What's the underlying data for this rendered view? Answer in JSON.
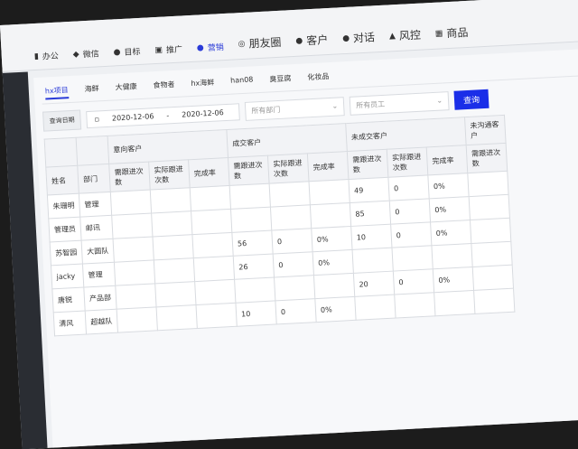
{
  "topnav": [
    {
      "icon": "briefcase-icon",
      "glyph": "▮",
      "label": "办公"
    },
    {
      "icon": "tag-icon",
      "glyph": "◆",
      "label": "微信"
    },
    {
      "icon": "target-icon",
      "glyph": "●",
      "label": "目标"
    },
    {
      "icon": "monitor-icon",
      "glyph": "▣",
      "label": "推广"
    },
    {
      "icon": "user-icon",
      "glyph": "●",
      "label": "营销",
      "active": true
    },
    {
      "icon": "circle-icon",
      "glyph": "◎",
      "label": "朋友圈"
    },
    {
      "icon": "users-icon",
      "glyph": "●",
      "label": "客户"
    },
    {
      "icon": "chat-icon",
      "glyph": "●",
      "label": "对话"
    },
    {
      "icon": "shield-icon",
      "glyph": "▲",
      "label": "风控"
    },
    {
      "icon": "grid-icon",
      "glyph": "▦",
      "label": "商品"
    }
  ],
  "tabs": [
    "hx项目",
    "海鲜",
    "大健康",
    "食物者",
    "hx海鲜",
    "han08",
    "臭豆腐",
    "化妆品"
  ],
  "filters": {
    "date_label": "查询日期",
    "start": "2020-12-06",
    "sep": "-",
    "end": "2020-12-06",
    "dept_placeholder": "所有部门",
    "staff_placeholder": "所有员工",
    "search": "查询"
  },
  "table": {
    "groups": [
      "意向客户",
      "成交客户",
      "未成交客户",
      "未沟通客户"
    ],
    "cols": [
      "姓名",
      "部门",
      "需跟进次数",
      "实际跟进次数",
      "完成率"
    ],
    "rows": [
      {
        "name": "朱珊明",
        "dept": "管理",
        "v": [
          "",
          "",
          "",
          "",
          "",
          "",
          "49",
          "0",
          "0%",
          ""
        ]
      },
      {
        "name": "管理员",
        "dept": "邮讯",
        "v": [
          "",
          "",
          "",
          "",
          "",
          "",
          "85",
          "0",
          "0%",
          ""
        ]
      },
      {
        "name": "苏智园",
        "dept": "大圆队",
        "v": [
          "",
          "",
          "",
          "56",
          "0",
          "0%",
          "10",
          "0",
          "0%",
          ""
        ]
      },
      {
        "name": "jacky",
        "dept": "管理",
        "v": [
          "",
          "",
          "",
          "26",
          "0",
          "0%",
          "",
          "",
          "",
          ""
        ]
      },
      {
        "name": "唐锐",
        "dept": "产品部",
        "v": [
          "",
          "",
          "",
          "",
          "",
          "",
          "20",
          "0",
          "0%",
          ""
        ]
      },
      {
        "name": "清风",
        "dept": "超越队",
        "v": [
          "",
          "",
          "",
          "10",
          "0",
          "0%",
          "",
          "",
          "",
          ""
        ]
      }
    ]
  }
}
